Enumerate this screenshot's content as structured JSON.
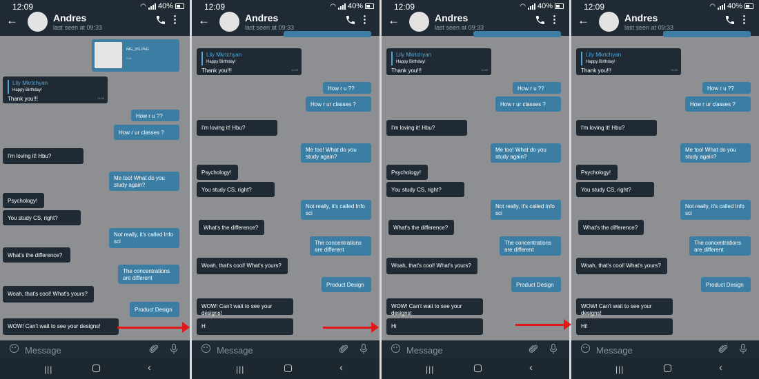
{
  "status": {
    "time": "12:09",
    "battery": "40%"
  },
  "header": {
    "name": "Andres",
    "last_seen": "last seen at 09:33"
  },
  "image_message": {
    "filename": "IMG_331.PNG",
    "size": "0.6b"
  },
  "reply": {
    "author": "Lily Mkrtchyan",
    "quoted": "Happy Birthday!",
    "text": "Thank you!!!",
    "time": "11:40"
  },
  "messages": {
    "how_ru": "How r u ??",
    "classes": "How r ur classes ?",
    "loving": "I'm loving it! Hbu?",
    "me_too": "Me too! What do you study again?",
    "psych": "Psychology!",
    "cs": "You study CS, right?",
    "infosci": "Not really, it's called Info sci",
    "difference": "What's the difference?",
    "concentrations": "The concentrations are different",
    "cool": "Woah, that's cool! What's yours?",
    "product": "Product Design",
    "wow": "WOW! Can't wait to see your designs!"
  },
  "typed_progression": [
    "H",
    "Hi",
    "Hi!"
  ],
  "input": {
    "placeholder": "Message"
  },
  "colors": {
    "header": "#1f2a34",
    "incoming": "#1f2a34",
    "outgoing": "#3c7ea3",
    "background": "#8d8f92",
    "arrow": "#e01818"
  }
}
